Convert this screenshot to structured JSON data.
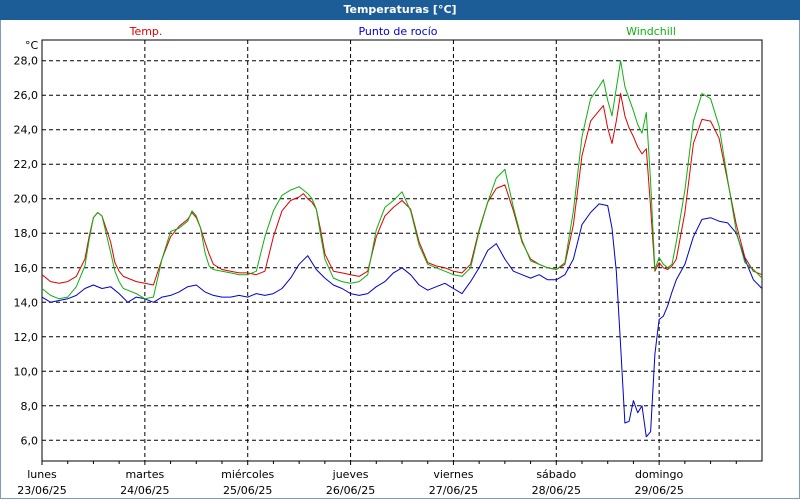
{
  "window": {
    "title": "Temperaturas [°C]"
  },
  "legend": [
    {
      "name": "Temp.",
      "color": "#e00000"
    },
    {
      "name": "Punto de rocío",
      "color": "#0000d0"
    },
    {
      "name": "Windchill",
      "color": "#10b010"
    }
  ],
  "chart_data": {
    "type": "line",
    "title": "Temperaturas [°C]",
    "ylabel": "°C",
    "xlabel": "",
    "ylim": [
      4.8,
      29.2
    ],
    "y_ticks": [
      "6,0",
      "8,0",
      "10,0",
      "12,0",
      "14,0",
      "16,0",
      "18,0",
      "20,0",
      "22,0",
      "24,0",
      "26,0",
      "28,0"
    ],
    "y_tick_values": [
      6,
      8,
      10,
      12,
      14,
      16,
      18,
      20,
      22,
      24,
      26,
      28
    ],
    "x_unit": "hours since 23/06/25 00:00",
    "xlim": [
      0,
      168
    ],
    "x_ticks": [
      {
        "day": "lunes",
        "date": "23/06/25"
      },
      {
        "day": "martes",
        "date": "24/06/25"
      },
      {
        "day": "miércoles",
        "date": "25/06/25"
      },
      {
        "day": "jueves",
        "date": "26/06/25"
      },
      {
        "day": "viernes",
        "date": "27/06/25"
      },
      {
        "day": "sábado",
        "date": "28/06/25"
      },
      {
        "day": "domingo",
        "date": "29/06/25"
      }
    ],
    "grid": true,
    "series": [
      {
        "name": "Temp.",
        "color": "#e00000",
        "x": [
          0,
          2,
          4,
          6,
          8,
          10,
          11,
          12,
          13,
          14,
          16,
          17,
          18,
          19,
          20,
          22,
          24,
          26,
          28,
          30,
          32,
          34,
          35,
          36,
          37,
          38,
          39,
          40,
          42,
          44,
          46,
          48,
          50,
          52,
          54,
          56,
          58,
          60,
          61,
          62,
          63,
          64,
          65,
          66,
          68,
          70,
          72,
          74,
          76,
          78,
          80,
          82,
          84,
          86,
          88,
          90,
          92,
          94,
          96,
          98,
          100,
          102,
          104,
          106,
          108,
          110,
          112,
          114,
          116,
          118,
          120,
          122,
          124,
          126,
          128,
          130,
          131,
          132,
          133,
          134,
          135,
          136,
          137,
          138,
          139,
          140,
          141,
          142,
          143,
          144,
          145,
          146,
          147,
          148,
          150,
          152,
          154,
          156,
          158,
          160,
          162,
          164,
          166,
          168
        ],
        "y": [
          15.6,
          15.2,
          15.1,
          15.2,
          15.5,
          16.5,
          17.8,
          18.9,
          19.2,
          19.0,
          17.5,
          16.3,
          15.8,
          15.5,
          15.4,
          15.2,
          15.1,
          15.0,
          16.5,
          17.8,
          18.4,
          18.8,
          19.2,
          18.9,
          18.3,
          17.5,
          16.8,
          16.2,
          15.9,
          15.8,
          15.7,
          15.7,
          15.6,
          15.8,
          17.8,
          19.3,
          19.9,
          20.1,
          20.3,
          20.0,
          19.8,
          19.4,
          18.2,
          16.8,
          15.8,
          15.7,
          15.6,
          15.5,
          15.8,
          17.8,
          19.0,
          19.5,
          19.9,
          19.4,
          17.5,
          16.3,
          16.1,
          16.0,
          15.8,
          15.7,
          16.2,
          18.2,
          19.8,
          20.6,
          20.8,
          19.3,
          17.5,
          16.5,
          16.2,
          16.0,
          15.9,
          16.2,
          18.5,
          22.5,
          24.5,
          25.1,
          25.4,
          24.1,
          23.2,
          24.5,
          26.1,
          24.8,
          24.1,
          23.6,
          23.0,
          22.6,
          22.9,
          19.5,
          15.8,
          16.3,
          16.0,
          15.9,
          16.1,
          16.5,
          19.2,
          23.2,
          24.6,
          24.5,
          23.5,
          21.0,
          18.5,
          16.6,
          15.8,
          15.6
        ]
      },
      {
        "name": "Punto de rocío",
        "color": "#0000d0",
        "x": [
          0,
          2,
          4,
          6,
          8,
          10,
          12,
          14,
          16,
          18,
          20,
          22,
          24,
          26,
          28,
          30,
          32,
          34,
          36,
          38,
          40,
          42,
          44,
          46,
          48,
          50,
          52,
          54,
          56,
          58,
          60,
          62,
          64,
          66,
          68,
          70,
          72,
          74,
          76,
          78,
          80,
          82,
          84,
          86,
          88,
          90,
          92,
          94,
          96,
          98,
          100,
          102,
          104,
          106,
          108,
          110,
          112,
          114,
          116,
          118,
          120,
          122,
          124,
          126,
          128,
          130,
          132,
          133,
          134,
          135,
          136,
          137,
          138,
          139,
          140,
          141,
          142,
          143,
          144,
          145,
          146,
          147,
          148,
          150,
          152,
          154,
          156,
          158,
          160,
          162,
          164,
          166,
          168
        ],
        "y": [
          14.3,
          14.0,
          14.1,
          14.2,
          14.4,
          14.8,
          15.0,
          14.8,
          14.9,
          14.5,
          14.0,
          14.3,
          14.2,
          14.0,
          14.3,
          14.4,
          14.6,
          14.9,
          15.0,
          14.6,
          14.4,
          14.3,
          14.3,
          14.4,
          14.3,
          14.5,
          14.4,
          14.5,
          14.8,
          15.4,
          16.2,
          16.7,
          15.9,
          15.4,
          15.0,
          14.8,
          14.5,
          14.4,
          14.5,
          14.9,
          15.2,
          15.7,
          16.0,
          15.6,
          15.0,
          14.7,
          14.9,
          15.1,
          14.8,
          14.5,
          15.2,
          16.0,
          17.0,
          17.4,
          16.5,
          15.8,
          15.6,
          15.4,
          15.6,
          15.3,
          15.3,
          15.6,
          16.5,
          18.5,
          19.2,
          19.7,
          19.6,
          18.3,
          15.8,
          11.5,
          7.0,
          7.1,
          8.3,
          7.6,
          8.0,
          6.2,
          6.5,
          11.0,
          13.0,
          13.2,
          13.8,
          14.6,
          15.3,
          16.2,
          17.8,
          18.8,
          18.9,
          18.7,
          18.6,
          18.0,
          16.5,
          15.3,
          14.8
        ]
      },
      {
        "name": "Windchill",
        "color": "#10b010",
        "x": [
          0,
          2,
          4,
          6,
          8,
          10,
          11,
          12,
          13,
          14,
          16,
          17,
          18,
          19,
          20,
          22,
          24,
          26,
          28,
          30,
          32,
          34,
          35,
          36,
          37,
          38,
          39,
          40,
          42,
          44,
          46,
          48,
          50,
          52,
          54,
          56,
          58,
          60,
          61,
          62,
          63,
          64,
          65,
          66,
          68,
          70,
          72,
          74,
          76,
          78,
          80,
          82,
          84,
          86,
          88,
          90,
          92,
          94,
          96,
          98,
          100,
          102,
          104,
          106,
          108,
          110,
          112,
          114,
          116,
          118,
          120,
          122,
          124,
          126,
          128,
          130,
          131,
          132,
          133,
          134,
          135,
          136,
          137,
          138,
          139,
          140,
          141,
          142,
          143,
          144,
          145,
          146,
          147,
          148,
          150,
          152,
          154,
          156,
          158,
          160,
          162,
          164,
          166,
          168
        ],
        "y": [
          14.8,
          14.4,
          14.2,
          14.3,
          14.9,
          16.1,
          17.6,
          18.9,
          19.2,
          19.0,
          16.9,
          15.8,
          15.2,
          14.8,
          14.7,
          14.5,
          14.2,
          14.3,
          16.5,
          18.1,
          18.3,
          18.7,
          19.3,
          19.0,
          18.3,
          16.9,
          16.1,
          15.9,
          15.8,
          15.7,
          15.6,
          15.6,
          15.8,
          17.8,
          19.3,
          20.2,
          20.5,
          20.7,
          20.5,
          20.3,
          20.0,
          19.4,
          17.9,
          16.5,
          15.4,
          15.2,
          15.1,
          15.2,
          15.6,
          18.2,
          19.5,
          19.9,
          20.4,
          19.3,
          17.3,
          16.2,
          16.0,
          15.8,
          15.6,
          15.5,
          16.0,
          18.1,
          19.8,
          21.2,
          21.7,
          19.5,
          17.6,
          16.4,
          16.2,
          16.0,
          15.9,
          16.3,
          19.3,
          23.6,
          25.8,
          26.5,
          26.9,
          25.7,
          24.8,
          26.4,
          28.0,
          26.5,
          25.8,
          25.1,
          24.3,
          23.8,
          25.0,
          21.0,
          15.9,
          16.6,
          16.2,
          16.0,
          16.2,
          17.5,
          20.5,
          24.5,
          26.1,
          25.8,
          24.2,
          21.1,
          18.1,
          16.3,
          15.9,
          15.4
        ]
      }
    ]
  }
}
